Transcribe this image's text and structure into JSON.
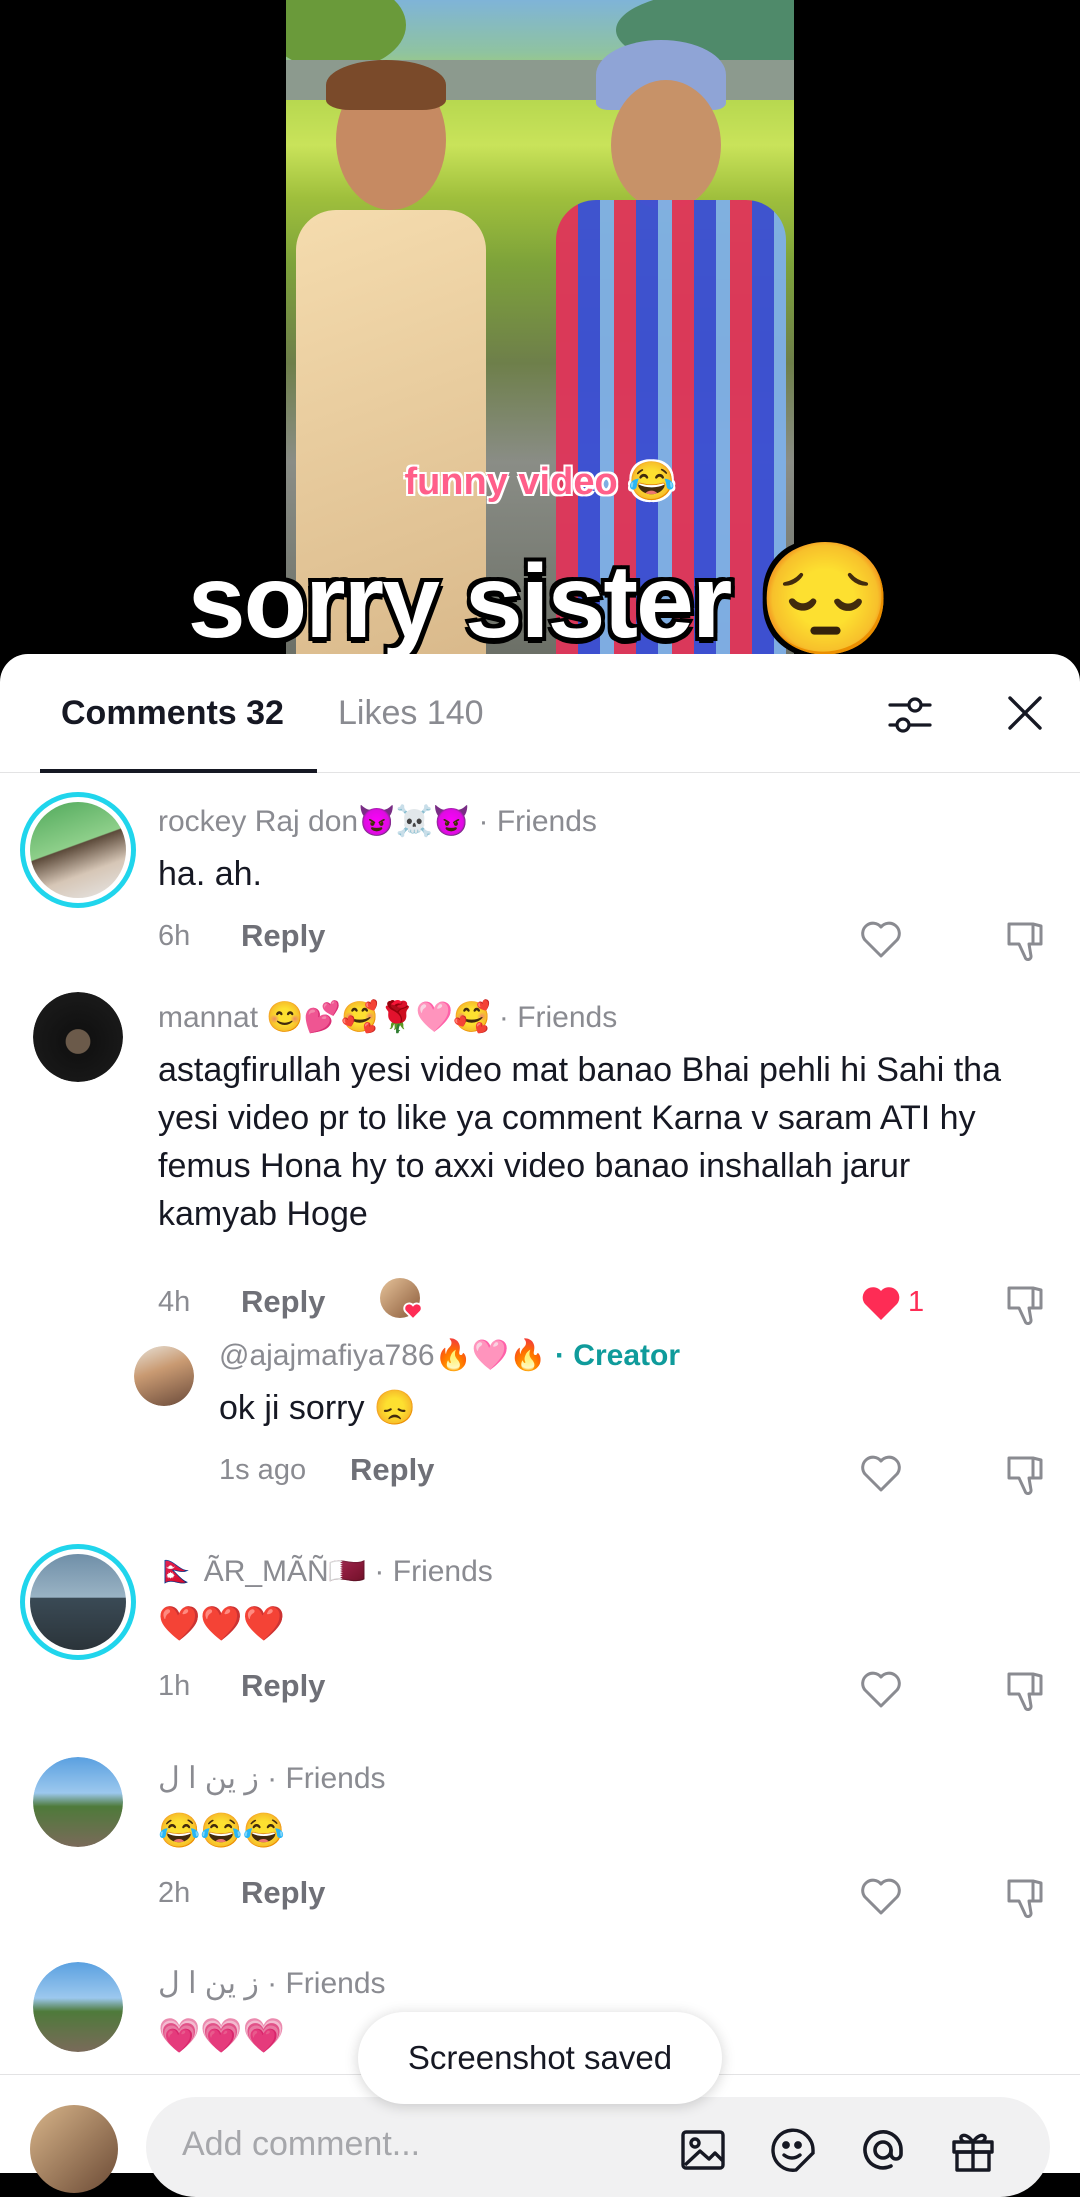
{
  "video": {
    "caption_small": "funny video 😂",
    "caption_big": "sorry sister",
    "caption_big_emoji": "😔"
  },
  "sheet": {
    "tabs": [
      {
        "label": "Comments 32",
        "active": true
      },
      {
        "label": "Likes 140",
        "active": false
      }
    ],
    "filter_icon": "sliders-icon",
    "close_icon": "close-icon"
  },
  "comments": [
    {
      "author": "rockey  Raj don😈☠️😈",
      "tag": "· Friends",
      "text": "ha. ah.",
      "time": "6h",
      "reply_label": "Reply",
      "liked": false,
      "like_count": ""
    },
    {
      "author": "mannat 😊💕🥰🌹🩷🥰",
      "tag": "· Friends",
      "text": "astagfirullah yesi video mat banao Bhai pehli hi Sahi tha yesi video pr to like ya comment Karna v saram ATI hy femus Hona hy to axxi video banao inshallah jarur kamyab Hoge",
      "time": "4h",
      "reply_label": "Reply",
      "liked": true,
      "like_count": "1"
    },
    {
      "author": "@ajajmafiya786🔥🩷🔥",
      "tag": "· Creator",
      "text": "ok ji sorry 😞",
      "time": "1s ago",
      "reply_label": "Reply",
      "liked": false,
      "like_count": ""
    },
    {
      "author": "🇳🇵 ÃR_MÃÑ🇶🇦",
      "tag": "· Friends",
      "text": "❤️❤️❤️",
      "time": "1h",
      "reply_label": "Reply",
      "liked": false,
      "like_count": ""
    },
    {
      "author": "ز ين ا ل",
      "tag": "· Friends",
      "text": "😂😂😂",
      "time": "2h",
      "reply_label": "Reply",
      "liked": false,
      "like_count": ""
    },
    {
      "author": "ز ين ا ل",
      "tag": "· Friends",
      "text": "💗💗💗",
      "time": "",
      "reply_label": "",
      "liked": false,
      "like_count": ""
    }
  ],
  "toast": "Screenshot saved",
  "composer": {
    "placeholder": "Add comment...",
    "icons": [
      "image-icon",
      "emoji-sticker-icon",
      "mention-icon",
      "gift-icon"
    ]
  },
  "colors": {
    "accent_red": "#fe2c55",
    "creator_teal": "#0f9b9b",
    "ring_cyan": "#20d5ec"
  }
}
